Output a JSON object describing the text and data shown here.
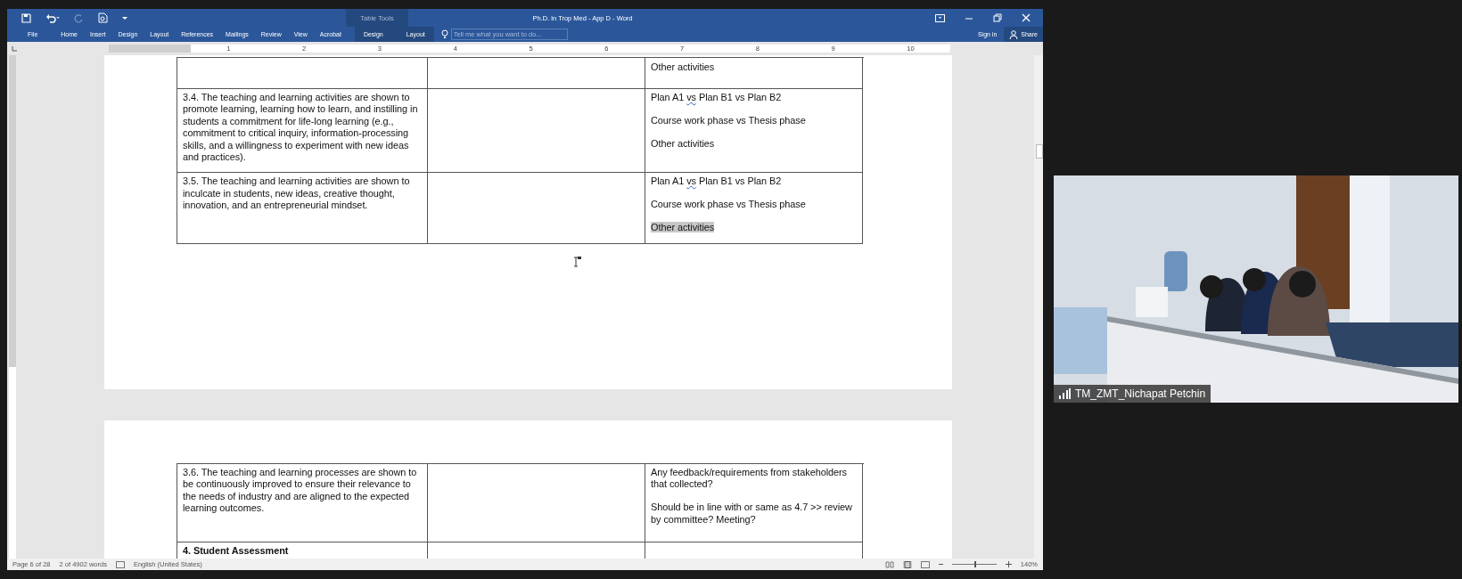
{
  "window": {
    "title": "Ph.D. in Trop Med - App D - Word",
    "context_group": "Table Tools"
  },
  "ribbon_tabs": [
    {
      "label": "File",
      "selected": false
    },
    {
      "label": "Home",
      "selected": false
    },
    {
      "label": "Insert",
      "selected": false
    },
    {
      "label": "Design",
      "selected": false
    },
    {
      "label": "Layout",
      "selected": false
    },
    {
      "label": "References",
      "selected": false
    },
    {
      "label": "Mailings",
      "selected": false
    },
    {
      "label": "Review",
      "selected": false
    },
    {
      "label": "View",
      "selected": false
    },
    {
      "label": "Acrobat",
      "selected": false
    }
  ],
  "context_tabs": [
    {
      "label": "Design",
      "selected": false
    },
    {
      "label": "Layout",
      "selected": false
    }
  ],
  "tell_me": {
    "placeholder": "Tell me what you want to do..."
  },
  "account": {
    "sign_in": "Sign in",
    "share": "Share"
  },
  "ruler": [
    "1",
    "2",
    "3",
    "4",
    "5",
    "6",
    "7",
    "8",
    "9",
    "10"
  ],
  "pages": [
    {
      "rows": [
        {
          "kind": "item",
          "criterion": "",
          "notes": [
            [
              {
                "text": "Other activities",
                "flagged": false,
                "highlighted": false
              }
            ]
          ]
        },
        {
          "kind": "item",
          "criterion": "3.4. The teaching and learning activities are shown to promote learning, learning how to learn, and instilling in students a commitment for life-long learning (e.g., commitment to critical inquiry, information-processing skills, and a willingness to experiment with new ideas and practices).",
          "notes": [
            [
              {
                "text": "Plan A1 ",
                "flagged": false,
                "highlighted": false
              },
              {
                "text": "vs",
                "flagged": true,
                "highlighted": false
              },
              {
                "text": " Plan B1 vs Plan B2",
                "flagged": false,
                "highlighted": false
              }
            ],
            [
              {
                "text": "Course work phase vs Thesis phase",
                "flagged": false,
                "highlighted": false
              }
            ],
            [
              {
                "text": "Other activities",
                "flagged": false,
                "highlighted": false
              }
            ]
          ]
        },
        {
          "kind": "item",
          "criterion": "3.5. The teaching and learning activities are shown to inculcate in students, new ideas, creative thought, innovation, and an entrepreneurial mindset.",
          "notes": [
            [
              {
                "text": "Plan A1 ",
                "flagged": false,
                "highlighted": false
              },
              {
                "text": "vs",
                "flagged": true,
                "highlighted": false
              },
              {
                "text": " Plan B1 vs Plan B2",
                "flagged": false,
                "highlighted": false
              }
            ],
            [
              {
                "text": "Course work phase vs Thesis phase",
                "flagged": false,
                "highlighted": false
              }
            ],
            [
              {
                "text": "Other activities",
                "flagged": false,
                "highlighted": true
              }
            ]
          ]
        }
      ]
    },
    {
      "rows": [
        {
          "kind": "item",
          "criterion": "3.6. The teaching and learning processes are shown to be continuously improved to ensure their relevance to the needs of industry and are aligned to the expected learning outcomes.",
          "notes": [
            [
              {
                "text": "Any feedback/requirements from stakeholders that collected?",
                "flagged": false,
                "highlighted": false
              }
            ],
            [
              {
                "text": "Should be in line with or same as 4.7 >> review by committee? Meeting?",
                "flagged": false,
                "highlighted": false
              }
            ]
          ]
        },
        {
          "kind": "heading",
          "criterion": "4. Student Assessment",
          "notes": []
        }
      ]
    }
  ],
  "status_bar": {
    "page": "Page 6 of 28",
    "words": "2 of 4902 words",
    "language": "English (United States)",
    "zoom": "140%",
    "zoom_slider": {
      "level": 0.5
    }
  },
  "video": {
    "participant": "TM_ZMT_Nichapat Petchin"
  }
}
